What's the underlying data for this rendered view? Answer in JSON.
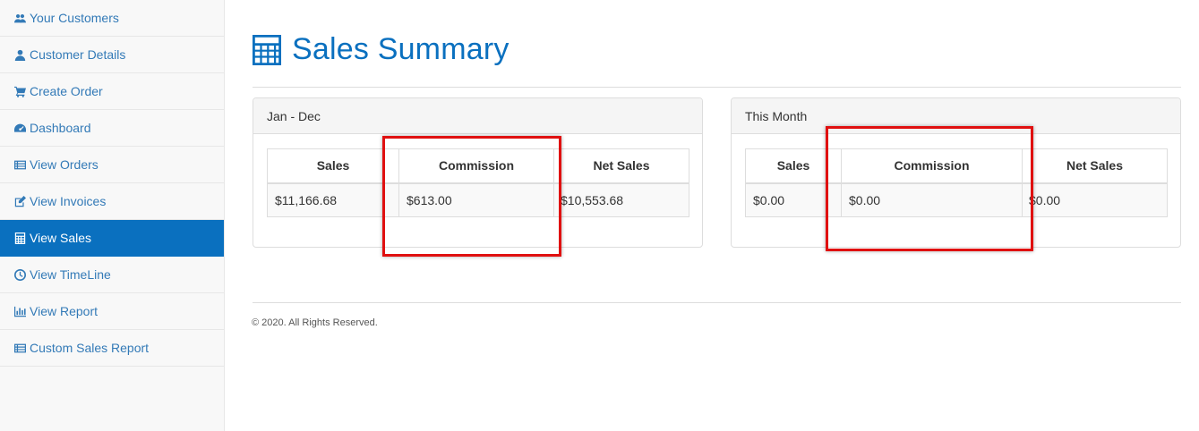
{
  "sidebar": {
    "items": [
      {
        "label": "Your Customers",
        "icon": "users-icon"
      },
      {
        "label": "Customer Details",
        "icon": "user-icon"
      },
      {
        "label": "Create Order",
        "icon": "cart-icon"
      },
      {
        "label": "Dashboard",
        "icon": "dashboard-icon"
      },
      {
        "label": "View Orders",
        "icon": "list-icon"
      },
      {
        "label": "View Invoices",
        "icon": "edit-icon"
      },
      {
        "label": "View Sales",
        "icon": "calculator-icon",
        "active": true
      },
      {
        "label": "View TimeLine",
        "icon": "clock-icon"
      },
      {
        "label": "View Report",
        "icon": "bar-chart-icon"
      },
      {
        "label": "Custom Sales Report",
        "icon": "list-icon"
      }
    ]
  },
  "header": {
    "title": "Sales Summary",
    "icon": "calculator-icon"
  },
  "panels": {
    "year": {
      "heading": "Jan - Dec",
      "columns": [
        "Sales",
        "Commission",
        "Net Sales"
      ],
      "values": [
        "$11,166.68",
        "$613.00",
        "$10,553.68"
      ]
    },
    "month": {
      "heading": "This Month",
      "columns": [
        "Sales",
        "Commission",
        "Net Sales"
      ],
      "values": [
        "$0.00",
        "$0.00",
        "$0.00"
      ]
    }
  },
  "footer": {
    "text": "© 2020. All Rights Reserved."
  },
  "colors": {
    "accent": "#0a70bf",
    "link": "#337ab7",
    "highlight": "#e01010"
  }
}
